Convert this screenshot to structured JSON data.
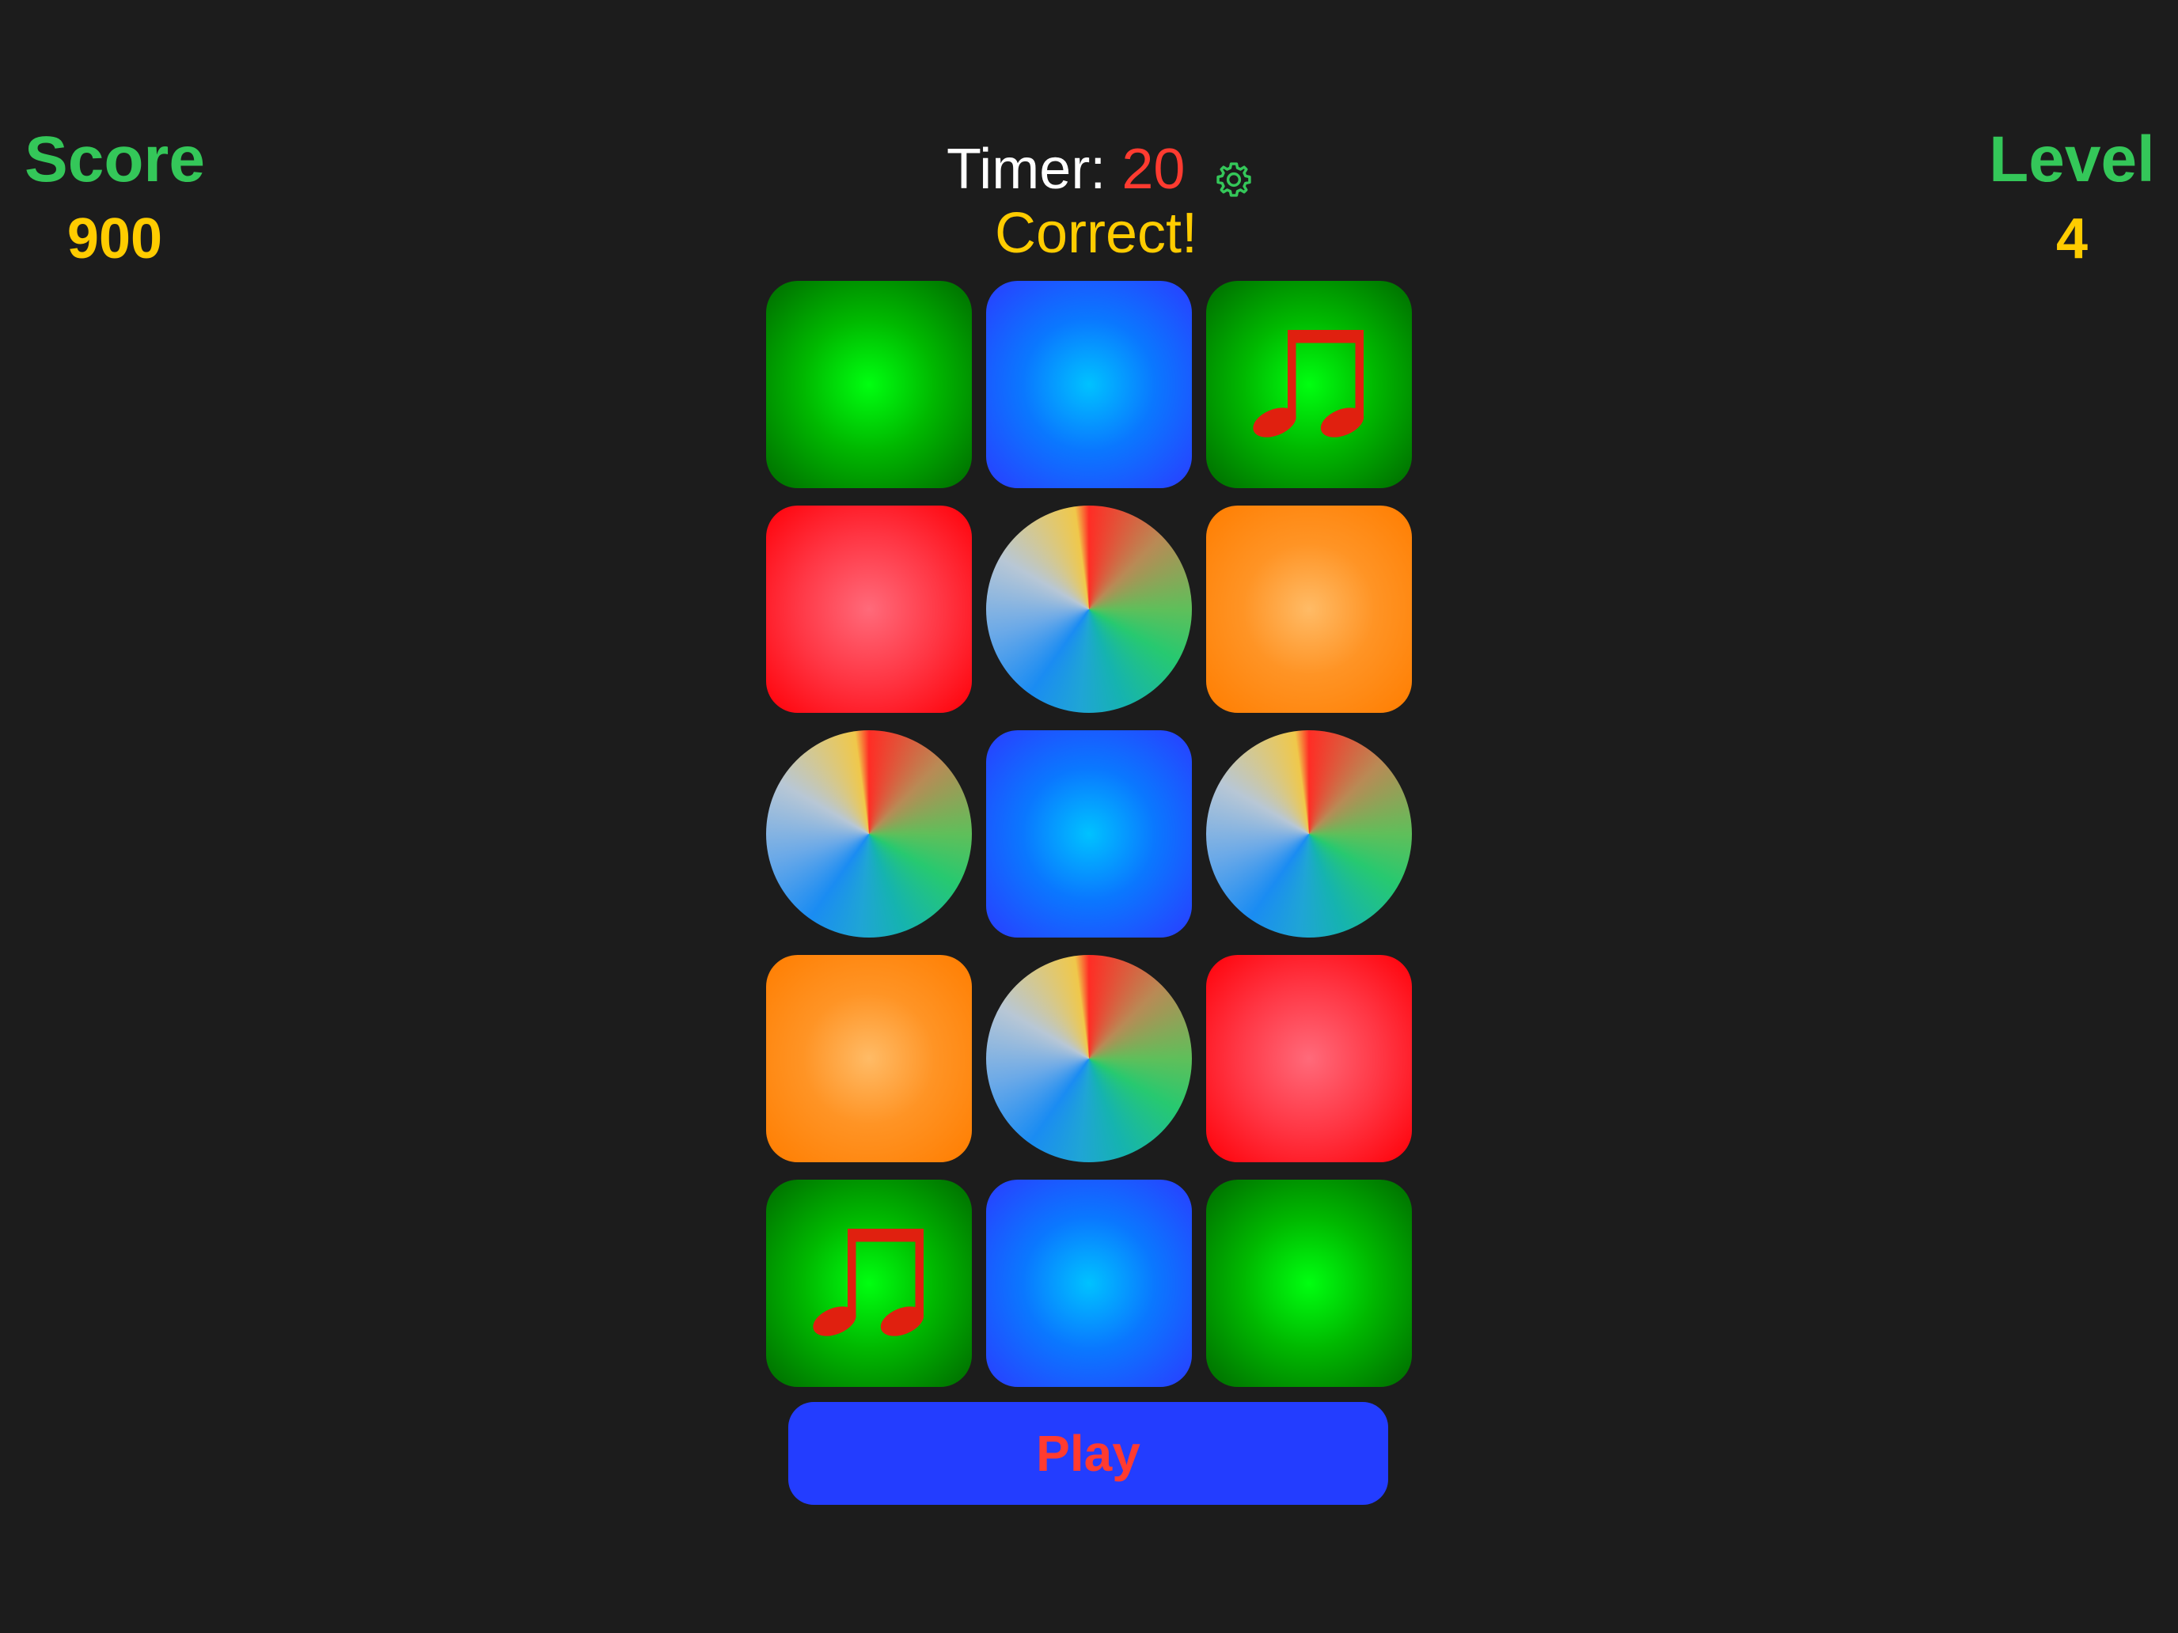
{
  "score": {
    "label": "Score",
    "value": "900"
  },
  "level": {
    "label": "Level",
    "value": "4"
  },
  "timer": {
    "label": "Timer:",
    "value": "20"
  },
  "status": "Correct!",
  "play_button": "Play",
  "icons": {
    "settings": "gear-icon",
    "note": "music-note-icon"
  },
  "colors": {
    "background": "#1c1c1c",
    "label_green": "#34c759",
    "value_yellow": "#ffcc00",
    "timer_red": "#ff3b30",
    "play_blue": "#233dff",
    "note_red": "#e0200f"
  },
  "tiles": [
    {
      "color": "green",
      "icon": ""
    },
    {
      "color": "blue",
      "icon": ""
    },
    {
      "color": "green",
      "icon": "music-note"
    },
    {
      "color": "red",
      "icon": ""
    },
    {
      "color": "wheel",
      "icon": ""
    },
    {
      "color": "orange",
      "icon": ""
    },
    {
      "color": "wheel",
      "icon": ""
    },
    {
      "color": "blue",
      "icon": ""
    },
    {
      "color": "wheel",
      "icon": ""
    },
    {
      "color": "orange",
      "icon": ""
    },
    {
      "color": "wheel",
      "icon": ""
    },
    {
      "color": "red",
      "icon": ""
    },
    {
      "color": "green",
      "icon": "music-note"
    },
    {
      "color": "blue",
      "icon": ""
    },
    {
      "color": "green",
      "icon": ""
    }
  ]
}
